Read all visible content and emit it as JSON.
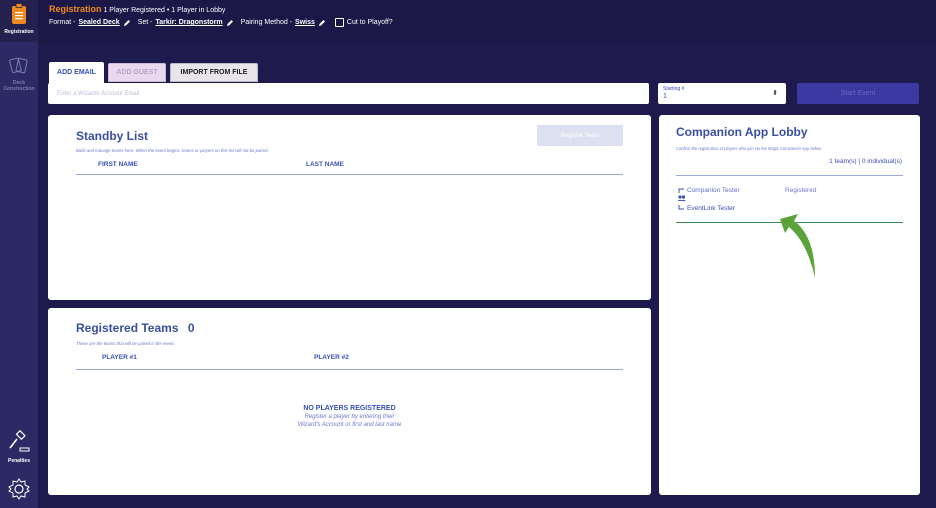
{
  "sidebar": {
    "items": [
      {
        "label": "Registration",
        "icon": "clipboard-icon"
      },
      {
        "label": "Deck Construction",
        "icon": "cards-icon"
      },
      {
        "label": "Penalties",
        "icon": "gavel-icon"
      },
      {
        "label": "",
        "icon": "gear-icon"
      }
    ]
  },
  "header": {
    "title": "Registration",
    "subtitle": "1 Player Registered • 1 Player in Lobby",
    "format_label": "Format -",
    "format_value": "Sealed Deck",
    "set_label": "Set -",
    "set_value": "Tarkir: Dragonstorm",
    "pairing_label": "Pairing Method -",
    "pairing_value": "Swiss",
    "cut_label": "Cut to Playoff?"
  },
  "tabs": [
    {
      "label": "ADD EMAIL"
    },
    {
      "label": "ADD GUEST"
    },
    {
      "label": "IMPORT FROM FILE"
    }
  ],
  "email": {
    "placeholder": "Enter a Wizards Account Email",
    "value": ""
  },
  "starting": {
    "label": "Starting #",
    "value": "1"
  },
  "start_button": "Start Event",
  "standby": {
    "title": "Standby List",
    "subtitle": "Build and manage teams here. When the event begins, teams or players on this list will not be paired.",
    "columns": [
      "FIRST NAME",
      "LAST NAME"
    ],
    "register_button": "Register Team"
  },
  "registered": {
    "title": "Registered Teams",
    "count": "0",
    "subtitle": "These are the teams that will be paired in the event.",
    "columns": [
      "PLAYER #1",
      "PLAYER #2"
    ],
    "empty_title": "NO PLAYERS REGISTERED",
    "empty_line1": "Register a player by entering their",
    "empty_line2": "Wizard's Account or first and last name"
  },
  "lobby": {
    "title": "Companion App Lobby",
    "subtitle": "Confirm the registration of players who join via the Magic Companion App below.",
    "counts": "1 team(s) | 0 individual(s)",
    "members": [
      "Companion Tester",
      "EventLink Tester"
    ],
    "status": "Registered"
  },
  "colors": {
    "background": "#1e1a4d",
    "accent_orange": "#f08a1e",
    "primary_blue": "#3a4fa3",
    "arrow_green": "#5aa33a"
  }
}
